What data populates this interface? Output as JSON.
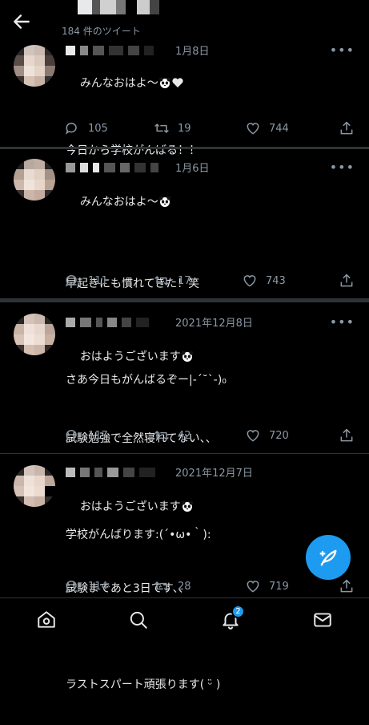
{
  "header": {
    "back_icon": "arrow-left-icon",
    "tweet_count": "184 件のツイート"
  },
  "tweets": [
    {
      "date": "1月8日",
      "lines": [
        "みんなおはよ〜",
        "",
        "今日から学校がんばる！！"
      ],
      "first_line_emoji": [
        "panda-face-emoji",
        "heart-emoji"
      ],
      "reply_count": "105",
      "retweet_count": "19",
      "like_count": "744"
    },
    {
      "date": "1月6日",
      "lines": [
        "みんなおはよ〜",
        "",
        "早起きにも慣れてきた！笑",
        "",
        "さあ今日もがんばるぞー|-ˊ˘ˋ-)₀"
      ],
      "first_line_emoji": [
        "panda-face-emoji"
      ],
      "reply_count": "111",
      "retweet_count": "17",
      "like_count": "743"
    },
    {
      "date": "2021年12月8日",
      "lines": [
        "おはようございます",
        "",
        "試験勉強で全然寝れてない、、",
        "",
        "学校がんばります:(´•ω•｀):"
      ],
      "first_line_emoji": [
        "panda-face-emoji"
      ],
      "reply_count": "117",
      "retweet_count": "42",
      "like_count": "720"
    },
    {
      "date": "2021年12月7日",
      "lines": [
        "おはようございます",
        "",
        "試験まであと3日です、、",
        "",
        "ラストスパート頑張ります( ᵕ̈ )"
      ],
      "first_line_emoji": [
        "panda-face-emoji"
      ],
      "reply_count": "114",
      "retweet_count": "28",
      "like_count": "719"
    }
  ],
  "more_label": "•••",
  "fab_icon": "compose-feather-icon",
  "bottom_nav": {
    "items": [
      "home-icon",
      "search-icon",
      "bell-icon",
      "mail-icon"
    ],
    "notification_badge": "2"
  },
  "colors": {
    "background": "#000000",
    "text": "#e7e9ea",
    "muted": "#8b98a5",
    "accent": "#1d9bf0",
    "divider": "#2f3336"
  }
}
